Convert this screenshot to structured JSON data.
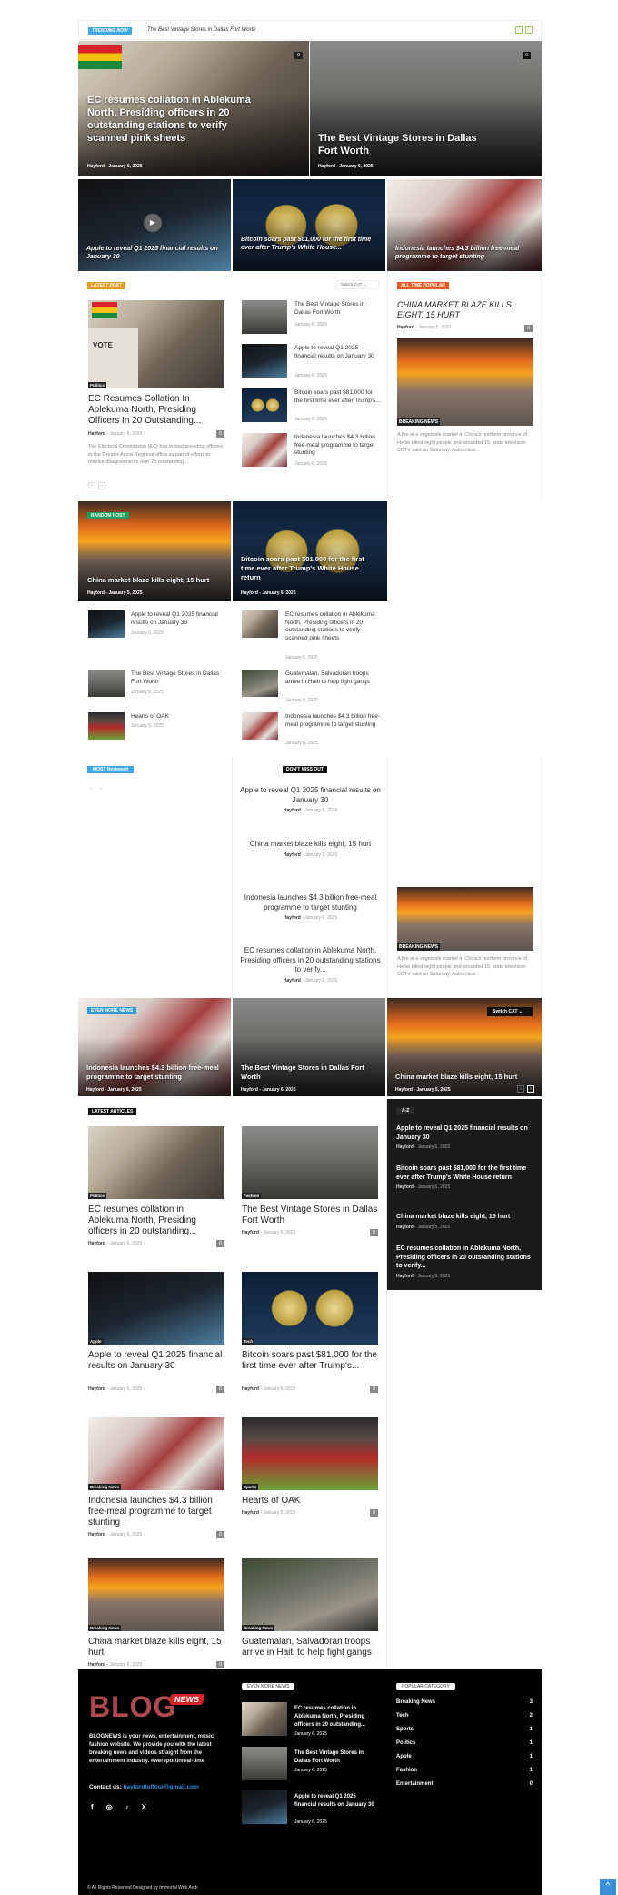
{
  "trending": {
    "label": "TRENDING NOW",
    "headline": "The Best Vintage Stores in Dallas Fort Worth"
  },
  "hero": [
    {
      "title": "EC resumes collation in Ablekuma North, Presiding officers in 20 outstanding stations to verify scanned pink sheets",
      "author": "Hayford",
      "date": "January 6, 2025",
      "comments": "0"
    },
    {
      "title": "The Best Vintage Stores in Dallas Fort Worth",
      "author": "Hayford",
      "date": "January 6, 2025",
      "comments": "0"
    }
  ],
  "hero_row": [
    {
      "title": "Apple to reveal Q1 2025 financial results on January 30"
    },
    {
      "title": "Bitcoin soars past $81,000 for the first time ever after Trump's White House..."
    },
    {
      "title": "Indonesia launches $4.3 billion free-meal programme to target stunting"
    }
  ],
  "latest_post": {
    "label": "LATEST POST",
    "switch": "Switch CAT",
    "main": {
      "category": "Politics",
      "title": "EC Resumes Collation In Ablekuma North, Presiding Officers In 20 Outstanding...",
      "author": "Hayford",
      "date": "January 6, 2025",
      "comments": "0",
      "excerpt": "The Electoral Commission (EC) has invited presiding officers to the Greater Accra Regional office as part of efforts to resolve disagreements over 20 outstanding..."
    },
    "list": [
      {
        "title": "The Best Vintage Stores in Dallas Fort Worth",
        "date": "January 6, 2025"
      },
      {
        "title": "Apple to reveal Q1 2025 financial results on January 30",
        "date": "January 6, 2025"
      },
      {
        "title": "Bitcoin soars past $81,000 for the first time ever after Trump's...",
        "date": "January 6, 2025"
      },
      {
        "title": "Indonesia launches $4.3 billion free-meal programme to target stunting",
        "date": "January 6, 2025"
      }
    ]
  },
  "all_time_popular": {
    "label": "ALL TIME POPULAR",
    "title": "CHINA MARKET BLAZE KILLS EIGHT, 15 HURT",
    "author": "Hayford",
    "date": "January 5, 2025",
    "comments": "0",
    "category": "BREAKING NEWS",
    "excerpt": "A fire at a vegetable market in China's northern province of Hebei killed eight people and wounded 15, state television CCTV said on Saturday. Authorities..."
  },
  "random_post": {
    "label": "RANDOM POST",
    "big": [
      {
        "title": "China market blaze kills eight, 15 hurt",
        "author": "Hayford",
        "date": "January 5, 2025"
      },
      {
        "title": "Bitcoin soars past $81,000 for the first time ever after Trump's White House return",
        "author": "Hayford",
        "date": "January 6, 2025"
      }
    ],
    "list": [
      {
        "title": "Apple to reveal Q1 2025 financial results on January 30",
        "date": "January 6, 2025"
      },
      {
        "title": "EC resumes collation in Ablekuma North, Presiding officers in 20 outstanding stations to verify scanned pink sheets",
        "date": "January 6, 2025"
      },
      {
        "title": "The Best Vintage Stores in Dallas Fort Worth",
        "date": "January 6, 2025"
      },
      {
        "title": "Guatemalan, Salvadoran troops arrive in Haiti to help fight gangs",
        "date": "January 5, 2025"
      },
      {
        "title": "Hearts of OAK",
        "date": "January 5, 2025"
      },
      {
        "title": "Indonesia launches $4.3 billion free-meal programme to target stunting",
        "date": "January 6, 2025"
      }
    ]
  },
  "most_reviewed": {
    "label": "MOST Reviewed"
  },
  "dont_miss": {
    "label": "DON'T MISS OUT",
    "items": [
      {
        "title": "Apple to reveal Q1 2025 financial results on January 30",
        "author": "Hayford",
        "date": "January 6, 2025"
      },
      {
        "title": "China market blaze kills eight, 15 hurt",
        "author": "Hayford",
        "date": "January 5, 2025"
      },
      {
        "title": "Indonesia launches $4.3 billion free-meal programme to target stunting",
        "author": "Hayford",
        "date": "January 6, 2025"
      },
      {
        "title": "EC resumes collation in Ablekuma North, Presiding officers in 20 outstanding stations to verify...",
        "author": "Hayford",
        "date": "January 6, 2025"
      }
    ]
  },
  "sidebar_breaking": {
    "category": "BREAKING NEWS",
    "excerpt": "A fire at a vegetable market in China's northern province of Hebei killed eight people and wounded 15, state television CCTV said on Saturday. Authorities..."
  },
  "even_more_news": {
    "label": "EVEN MORE NEWS",
    "switch": "Switch CAT",
    "items": [
      {
        "title": "Indonesia launches $4.3 billion free-meal programme to target stunting",
        "author": "Hayford",
        "date": "January 6, 2025"
      },
      {
        "title": "The Best Vintage Stores in Dallas Fort Worth",
        "author": "Hayford",
        "date": "January 6, 2025"
      },
      {
        "title": "China market blaze kills eight, 15 hurt",
        "author": "Hayford",
        "date": "January 5, 2025"
      }
    ]
  },
  "az": {
    "label": "A-Z",
    "items": [
      {
        "title": "Apple to reveal Q1 2025 financial results on January 30",
        "author": "Hayford",
        "date": "January 6, 2025"
      },
      {
        "title": "Bitcoin soars past $81,000 for the first time ever after Trump's White House return",
        "author": "Hayford",
        "date": "January 6, 2025"
      },
      {
        "title": "China market blaze kills eight, 15 hurt",
        "author": "Hayford",
        "date": "January 5, 2025"
      },
      {
        "title": "EC resumes collation in Ablekuma North, Presiding officers in 20 outstanding stations to verify...",
        "author": "Hayford",
        "date": "January 6, 2025"
      }
    ]
  },
  "latest_articles": {
    "label": "LATEST ARTICLES",
    "items": [
      {
        "category": "Politics",
        "title": "EC resumes collation in Ablekuma North, Presiding officers in 20 outstanding...",
        "author": "Hayford",
        "date": "January 6, 2025",
        "comments": "0"
      },
      {
        "category": "Fashion",
        "title": "The Best Vintage Stores in Dallas Fort Worth",
        "author": "Hayford",
        "date": "January 6, 2025",
        "comments": "0"
      },
      {
        "category": "Apple",
        "title": "Apple to reveal Q1 2025 financial results on January 30",
        "author": "Hayford",
        "date": "January 6, 2025",
        "comments": "0"
      },
      {
        "category": "Tech",
        "title": "Bitcoin soars past $81,000 for the first time ever after Trump's...",
        "author": "Hayford",
        "date": "January 6, 2025",
        "comments": "0"
      },
      {
        "category": "Breaking News",
        "title": "Indonesia launches $4.3 billion free-meal programme to target stunting",
        "author": "Hayford",
        "date": "January 6, 2025",
        "comments": "0"
      },
      {
        "category": "Sports",
        "title": "Hearts of OAK",
        "author": "Hayford",
        "date": "January 5, 2025",
        "comments": "0"
      },
      {
        "category": "Breaking News",
        "title": "China market blaze kills eight, 15 hurt",
        "author": "Hayford",
        "date": "January 5, 2025",
        "comments": "0"
      },
      {
        "category": "Breaking News",
        "title": "Guatemalan, Salvadoran troops arrive in Haiti to help fight gangs",
        "author": "Hayford",
        "date": "January 5, 2025",
        "comments": "0"
      }
    ]
  },
  "footer": {
    "logo_main": "BLOG",
    "logo_badge": "NEWS",
    "about": "BLOGNEWS is your news, entertainment, music fashion website. We provide you with the latest breaking news and videos straight from the entertainment industry. #wereportinreal-time",
    "contact_label": "Contact us:",
    "contact_email": "hayfordtuffour@gmail.com",
    "social": [
      "f",
      "◎",
      "♪",
      "X"
    ],
    "even_more_label": "EVEN MORE NEWS",
    "even_more": [
      {
        "title": "EC resumes collation in Ablekuma North, Presiding officers in 20 outstanding...",
        "date": "January 6, 2025"
      },
      {
        "title": "The Best Vintage Stores in Dallas Fort Worth",
        "date": "January 6, 2025"
      },
      {
        "title": "Apple to reveal Q1 2025 financial results on January 30",
        "date": "January 6, 2025"
      }
    ],
    "popular_label": "POPULAR CATEGORY",
    "categories": [
      {
        "name": "Breaking News",
        "count": "3"
      },
      {
        "name": "Tech",
        "count": "2"
      },
      {
        "name": "Sports",
        "count": "1"
      },
      {
        "name": "Politics",
        "count": "1"
      },
      {
        "name": "Apple",
        "count": "1"
      },
      {
        "name": "Fashion",
        "count": "1"
      },
      {
        "name": "Entertainment",
        "count": "0"
      }
    ],
    "copyright": "© All Rights Reserved Designed by Immortal Web Arch"
  },
  "colors": {
    "trending": "#3ea7e6",
    "latest": "#e89b16",
    "popular": "#ec5a24",
    "random": "#1aa05a",
    "reviewed": "#3ea7e6",
    "even_more": "#2d9ddb",
    "logo": "#b0494f",
    "badge_red": "#d8232a",
    "link": "#2d8fe0"
  }
}
